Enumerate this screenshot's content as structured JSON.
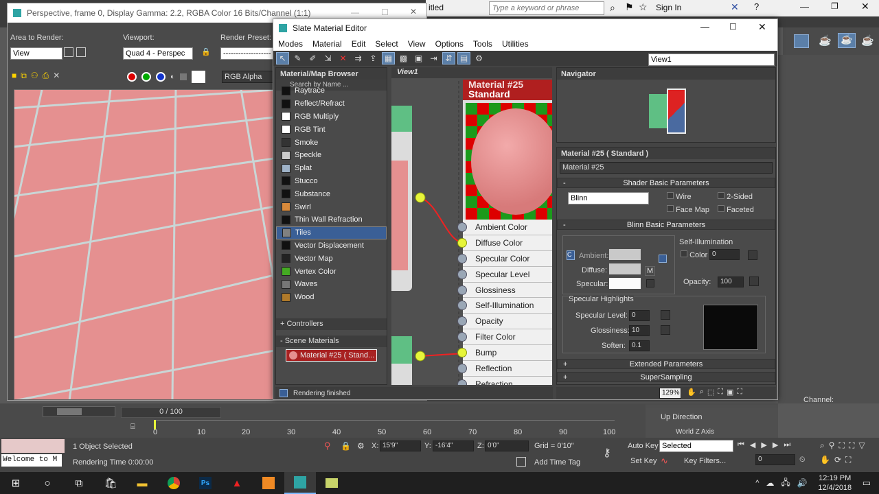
{
  "frame_window": {
    "title": "Perspective, frame 0, Display Gamma: 2.2, RGBA Color 16 Bits/Channel (1:1)",
    "area_label": "Area to Render:",
    "area_value": "View",
    "viewport_label": "Viewport:",
    "viewport_value": "Quad 4 - Perspec",
    "preset_label": "Render Preset:",
    "preset_value": "-------------------",
    "channel_value": "RGB Alpha"
  },
  "max_app": {
    "title_suffix": "itled",
    "search_placeholder": "Type a keyword or phrase",
    "sign_in": "Sign In"
  },
  "slate": {
    "title": "Slate Material Editor",
    "menus": [
      "Modes",
      "Material",
      "Edit",
      "Select",
      "View",
      "Options",
      "Tools",
      "Utilities"
    ],
    "view_dropdown": "View1",
    "browser_title": "Material/Map Browser",
    "search_placeholder": "Search by Name ...",
    "maps": [
      {
        "label": "Raytrace",
        "color": "#111111"
      },
      {
        "label": "Reflect/Refract",
        "color": "#111111"
      },
      {
        "label": "RGB Multiply",
        "color": "#ffffff"
      },
      {
        "label": "RGB Tint",
        "color": "#ffffff"
      },
      {
        "label": "Smoke",
        "color": "#333333"
      },
      {
        "label": "Speckle",
        "color": "#cccccc"
      },
      {
        "label": "Splat",
        "color": "#9fb3c8"
      },
      {
        "label": "Stucco",
        "color": "#111111"
      },
      {
        "label": "Substance",
        "color": "#111111"
      },
      {
        "label": "Swirl",
        "color": "#d98a3b"
      },
      {
        "label": "Thin Wall Refraction",
        "color": "#111111"
      },
      {
        "label": "Tiles",
        "color": "#808080"
      },
      {
        "label": "Vector Displacement",
        "color": "#111111"
      },
      {
        "label": "Vector Map",
        "color": "#222222"
      },
      {
        "label": "Vertex Color",
        "color": "#44aa22"
      },
      {
        "label": "Waves",
        "color": "#777777"
      },
      {
        "label": "Wood",
        "color": "#b07a2a"
      }
    ],
    "controllers": "+ Controllers",
    "scene_materials": "- Scene Materials",
    "scene_item": "Material #25  ( Stand...",
    "view_tab": "View1",
    "node_title_1": "Material #25",
    "node_title_2": "Standard",
    "slots": [
      "Ambient Color",
      "Diffuse Color",
      "Specular Color",
      "Specular Level",
      "Glossiness",
      "Self-Illumination",
      "Opacity",
      "Filter Color",
      "Bump",
      "Reflection",
      "Refraction"
    ],
    "navigator_title": "Navigator",
    "params_title": "Material #25  ( Standard )",
    "material_name": "Material #25",
    "shader_rollout": "Shader Basic Parameters",
    "shader_value": "Blinn",
    "wire": "Wire",
    "two_sided": "2-Sided",
    "face_map": "Face Map",
    "faceted": "Faceted",
    "blinn_rollout": "Blinn Basic Parameters",
    "self_illum": "Self-Illumination",
    "color_label": "Color",
    "color_value": "0",
    "ambient": "Ambient:",
    "diffuse": "Diffuse:",
    "specular": "Specular:",
    "m_button": "M",
    "opacity_label": "Opacity:",
    "opacity_value": "100",
    "spec_highlights": "Specular Highlights",
    "spec_level": "Specular Level:",
    "spec_level_value": "0",
    "glossiness": "Glossiness:",
    "glossiness_value": "10",
    "soften": "Soften:",
    "soften_value": "0.1",
    "extended": "Extended Parameters",
    "supersampling": "SuperSampling",
    "status": "Rendering finished",
    "zoom": "129%"
  },
  "timeline": {
    "frame": "0 / 100",
    "ticks": [
      "0",
      "10",
      "20",
      "30",
      "40",
      "50",
      "60",
      "70",
      "80",
      "90",
      "100"
    ]
  },
  "side_panel": {
    "channel": "Channel:",
    "up_direction": "Up Direction",
    "world_z": "World Z Axis"
  },
  "statusbar": {
    "script": "Welcome to M",
    "selected": "1 Object Selected",
    "render_time": "Rendering Time  0:00:00",
    "x_label": "X:",
    "x": "15'9\"",
    "y_label": "Y:",
    "y": "-16'4\"",
    "z_label": "Z:",
    "z": "0'0\"",
    "grid": "Grid = 0'10\"",
    "add_time_tag": "Add Time Tag",
    "auto_key": "Auto Key",
    "set_key": "Set Key",
    "selected_dd": "Selected",
    "key_filters": "Key Filters...",
    "frame_field": "0"
  },
  "taskbar": {
    "time": "12:19 PM",
    "date": "12/4/2018"
  }
}
